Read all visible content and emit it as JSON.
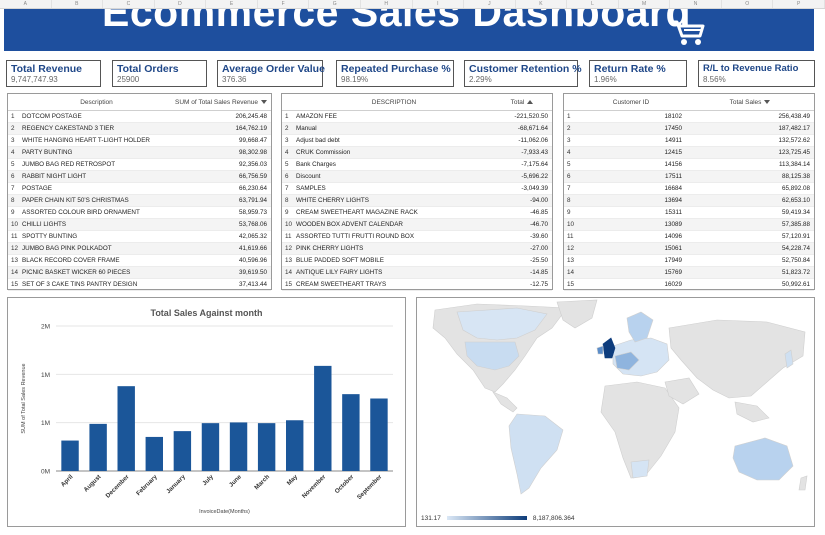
{
  "columns": [
    "A",
    "B",
    "C",
    "D",
    "E",
    "F",
    "G",
    "H",
    "I",
    "J",
    "K",
    "L",
    "M",
    "N",
    "O",
    "P"
  ],
  "banner": {
    "title": "Ecommerce Sales Dashboard"
  },
  "kpis": [
    {
      "label": "Total Revenue",
      "value": "9,747,747.93"
    },
    {
      "label": "Total Orders",
      "value": "25900"
    },
    {
      "label": "Average Order Value",
      "value": "376.36"
    },
    {
      "label": "Repeated Purchase %",
      "value": "98.19%"
    },
    {
      "label": "Customer Retention %",
      "value": "2.29%"
    },
    {
      "label": "Return Rate %",
      "value": "1.96%"
    },
    {
      "label": "R/L to Revenue Ratio",
      "value": "8.56%"
    }
  ],
  "table1": {
    "col1": "Description",
    "col2": "SUM of Total Sales Revenue",
    "rows": [
      [
        "1",
        "DOTCOM POSTAGE",
        "206,245.48"
      ],
      [
        "2",
        "REGENCY CAKESTAND 3 TIER",
        "164,762.19"
      ],
      [
        "3",
        "WHITE HANGING HEART T-LIGHT HOLDER",
        "99,668.47"
      ],
      [
        "4",
        "PARTY BUNTING",
        "98,302.98"
      ],
      [
        "5",
        "JUMBO BAG RED RETROSPOT",
        "92,356.03"
      ],
      [
        "6",
        "RABBIT NIGHT LIGHT",
        "66,756.59"
      ],
      [
        "7",
        "POSTAGE",
        "66,230.64"
      ],
      [
        "8",
        "PAPER CHAIN KIT 50'S CHRISTMAS",
        "63,791.94"
      ],
      [
        "9",
        "ASSORTED COLOUR BIRD ORNAMENT",
        "58,959.73"
      ],
      [
        "10",
        "CHILLI LIGHTS",
        "53,768.06"
      ],
      [
        "11",
        "SPOTTY BUNTING",
        "42,065.32"
      ],
      [
        "12",
        "JUMBO BAG PINK POLKADOT",
        "41,619.66"
      ],
      [
        "13",
        "BLACK RECORD COVER FRAME",
        "40,596.96"
      ],
      [
        "14",
        "PICNIC BASKET WICKER 60 PIECES",
        "39,619.50"
      ],
      [
        "15",
        "SET OF 3 CAKE TINS PANTRY DESIGN",
        "37,413.44"
      ]
    ]
  },
  "table2": {
    "col1": "DESCRIPTION",
    "col2": "Total",
    "rows": [
      [
        "1",
        "AMAZON FEE",
        "-221,520.50"
      ],
      [
        "2",
        "Manual",
        "-68,671.64"
      ],
      [
        "3",
        "Adjust bad debt",
        "-11,062.06"
      ],
      [
        "4",
        "CRUK Commission",
        "-7,933.43"
      ],
      [
        "5",
        "Bank Charges",
        "-7,175.64"
      ],
      [
        "6",
        "Discount",
        "-5,696.22"
      ],
      [
        "7",
        "SAMPLES",
        "-3,049.39"
      ],
      [
        "8",
        "WHITE CHERRY LIGHTS",
        "-94.00"
      ],
      [
        "9",
        "CREAM SWEETHEART MAGAZINE RACK",
        "-46.85"
      ],
      [
        "10",
        "WOODEN BOX ADVENT CALENDAR",
        "-46.70"
      ],
      [
        "11",
        "ASSORTED TUTTI FRUTTI ROUND BOX",
        "-39.60"
      ],
      [
        "12",
        "PINK CHERRY LIGHTS",
        "-27.00"
      ],
      [
        "13",
        "BLUE PADDED SOFT MOBILE",
        "-25.50"
      ],
      [
        "14",
        "ANTIQUE LILY FAIRY LIGHTS",
        "-14.85"
      ],
      [
        "15",
        "CREAM SWEETHEART TRAYS",
        "-12.75"
      ]
    ]
  },
  "table3": {
    "col1": "Customer ID",
    "col2": "Total Sales",
    "rows": [
      [
        "1",
        "18102",
        "256,438.49"
      ],
      [
        "2",
        "17450",
        "187,482.17"
      ],
      [
        "3",
        "14911",
        "132,572.62"
      ],
      [
        "4",
        "12415",
        "123,725.45"
      ],
      [
        "5",
        "14156",
        "113,384.14"
      ],
      [
        "6",
        "17511",
        "88,125.38"
      ],
      [
        "7",
        "16684",
        "65,892.08"
      ],
      [
        "8",
        "13694",
        "62,653.10"
      ],
      [
        "9",
        "15311",
        "59,419.34"
      ],
      [
        "10",
        "13089",
        "57,385.88"
      ],
      [
        "11",
        "14096",
        "57,120.91"
      ],
      [
        "12",
        "15061",
        "54,228.74"
      ],
      [
        "13",
        "17949",
        "52,750.84"
      ],
      [
        "14",
        "15769",
        "51,823.72"
      ],
      [
        "15",
        "16029",
        "50,992.61"
      ]
    ]
  },
  "chart_data": {
    "type": "bar",
    "title": "Total Sales Against month",
    "xlabel": "InvoiceDate(Months)",
    "ylabel": "SUM of Total Sales Revenue",
    "yticks": [
      "0M",
      "1M",
      "1M",
      "2M"
    ],
    "ylim": [
      0,
      2000000
    ],
    "categories": [
      "April",
      "August",
      "December",
      "February",
      "January",
      "July",
      "June",
      "March",
      "May",
      "November",
      "October",
      "September"
    ],
    "values": [
      420000,
      650000,
      1170000,
      470000,
      550000,
      660000,
      670000,
      660000,
      700000,
      1450000,
      1060000,
      1000000
    ],
    "color": "#1b5699"
  },
  "map": {
    "legend_min": "131.17",
    "legend_max": "8,187,806.364"
  }
}
